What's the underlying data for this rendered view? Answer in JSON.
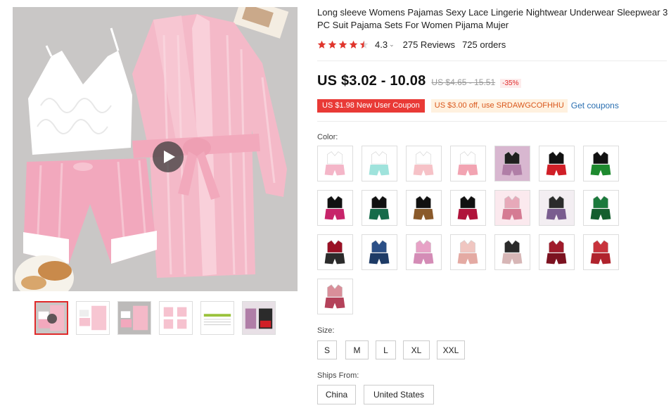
{
  "product": {
    "title": "Long sleeve Womens Pajamas Sexy Lace Lingerie Nightwear Underwear Sleepwear 3 PC Suit Pajama Sets For Women Pijama Mujer",
    "rating": "4.3",
    "reviews": "275 Reviews",
    "orders": "725 orders",
    "stars": 4.5
  },
  "price": {
    "current": "US $3.02 - 10.08",
    "original": "US $4.65 - 15.51",
    "discount": "-35%"
  },
  "coupons": {
    "new_user": "US $1.98 New User Coupon",
    "store": "US $3.00 off, use SRDAWGCOFHHU",
    "get_link": "Get coupons"
  },
  "color": {
    "label": "Color:",
    "swatches": [
      {
        "top": "#ffffff",
        "bottom": "#f4b6c8",
        "bg": "#ffffff"
      },
      {
        "top": "#ffffff",
        "bottom": "#9fe3dc",
        "bg": "#ffffff"
      },
      {
        "top": "#ffffff",
        "bottom": "#f6c2c7",
        "bg": "#ffffff"
      },
      {
        "top": "#ffffff",
        "bottom": "#f2a4b2",
        "bg": "#ffffff"
      },
      {
        "top": "#1f1f1f",
        "bottom": "#b07ea7",
        "bg": "#d8b7d0"
      },
      {
        "top": "#111111",
        "bottom": "#d01f27",
        "bg": "#ffffff"
      },
      {
        "top": "#111111",
        "bottom": "#1e8a2f",
        "bg": "#ffffff"
      },
      {
        "top": "#111111",
        "bottom": "#c7246a",
        "bg": "#ffffff"
      },
      {
        "top": "#111111",
        "bottom": "#166b4a",
        "bg": "#ffffff"
      },
      {
        "top": "#111111",
        "bottom": "#8a5a2b",
        "bg": "#ffffff"
      },
      {
        "top": "#111111",
        "bottom": "#b0143b",
        "bg": "#ffffff"
      },
      {
        "top": "#e7a9b9",
        "bottom": "#d57b93",
        "bg": "#fbe9ee"
      },
      {
        "top": "#2b2b2b",
        "bottom": "#7a5d8f",
        "bg": "#f3eef2"
      },
      {
        "top": "#1b7a3c",
        "bottom": "#145e2e",
        "bg": "#ffffff"
      },
      {
        "top": "#9a1024",
        "bottom": "#2b2b2b",
        "bg": "#ffffff"
      },
      {
        "top": "#2b4f86",
        "bottom": "#1e3b66",
        "bg": "#ffffff"
      },
      {
        "top": "#e7a2c6",
        "bottom": "#d48cb6",
        "bg": "#ffffff"
      },
      {
        "top": "#f0c6c1",
        "bottom": "#e4aaa3",
        "bg": "#ffffff"
      },
      {
        "top": "#2a2a2a",
        "bottom": "#d7b6b6",
        "bg": "#ffffff"
      },
      {
        "top": "#a01b2b",
        "bottom": "#7c1220",
        "bg": "#ffffff"
      },
      {
        "top": "#c8333c",
        "bottom": "#b0232d",
        "bg": "#ffffff"
      },
      {
        "top": "#d98f9a",
        "bottom": "#b4425a",
        "bg": "#ffffff"
      }
    ]
  },
  "size": {
    "label": "Size:",
    "options": [
      "S",
      "M",
      "L",
      "XL",
      "XXL"
    ]
  },
  "ships_from": {
    "label": "Ships From:",
    "options": [
      "China",
      "United States"
    ]
  },
  "gallery": {
    "thumb_count": 6
  }
}
